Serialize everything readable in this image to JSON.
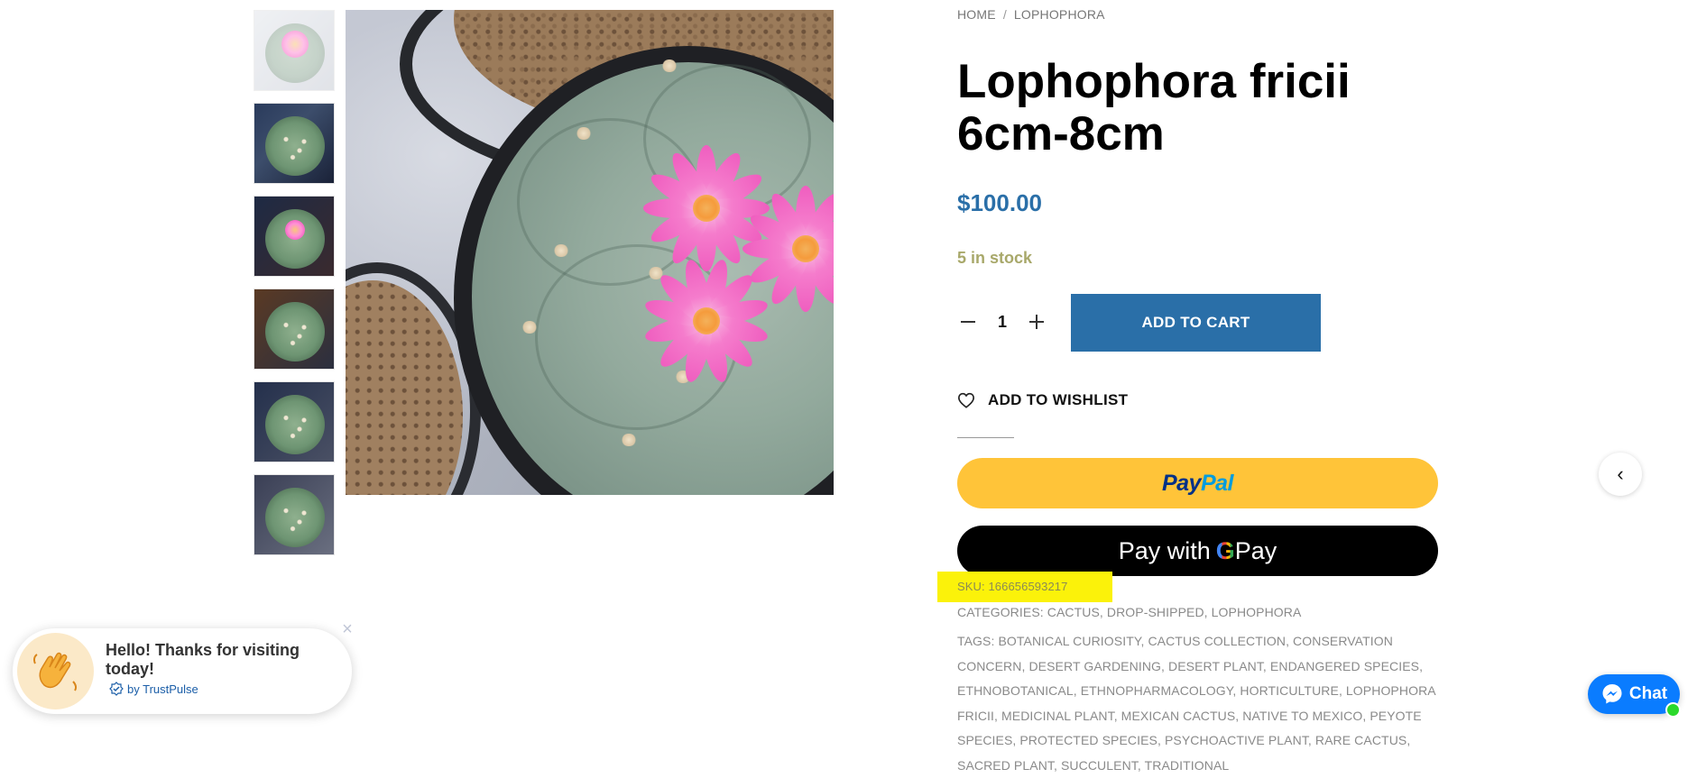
{
  "breadcrumb": {
    "home": "HOME",
    "separator": "/",
    "category": "LOPHOPHORA"
  },
  "product": {
    "title": "Lophophora fricii 6cm-8cm",
    "price": "$100.00",
    "stock": "5 in stock",
    "quantity": "1"
  },
  "actions": {
    "add_to_cart": "ADD TO CART",
    "wishlist": "ADD TO WISHLIST",
    "paypal_pay": "Pay",
    "paypal_pal": "Pal",
    "gpay_prefix": "Pay with",
    "gpay_g": "G",
    "gpay_pay": "Pay"
  },
  "meta": {
    "sku_label": "SKU:",
    "sku_value": "166656593217",
    "categories_label": "CATEGORIES:",
    "categories_value": "CACTUS, DROP-SHIPPED, LOPHOPHORA",
    "tags_label": "TAGS:",
    "tags_value": "BOTANICAL CURIOSITY, CACTUS COLLECTION, CONSERVATION CONCERN, DESERT GARDENING, DESERT PLANT, ENDANGERED SPECIES, ETHNOBOTANICAL, ETHNOPHARMACOLOGY, HORTICULTURE, LOPHOPHORA FRICII, MEDICINAL PLANT, MEXICAN CACTUS, NATIVE TO MEXICO, PEYOTE SPECIES, PROTECTED SPECIES, PSYCHOACTIVE PLANT, RARE CACTUS, SACRED PLANT, SUCCULENT, TRADITIONAL"
  },
  "trustpulse": {
    "message": "Hello! Thanks for visiting today!",
    "by": "by TrustPulse",
    "close": "×"
  },
  "chat": {
    "label": "Chat"
  },
  "nav": {
    "arrow": "‹"
  },
  "icons": {
    "wishlist": "heart-icon",
    "close": "close-icon",
    "messenger": "messenger-icon",
    "trustpulse": "check-badge-icon",
    "arrow": "chevron-left-icon"
  },
  "colors": {
    "accent": "#2a6fa8",
    "stock": "#a8a86a",
    "paypal": "#ffc439",
    "gpay": "#000000",
    "highlight": "#fbf20a",
    "chat": "#0a7cff"
  }
}
